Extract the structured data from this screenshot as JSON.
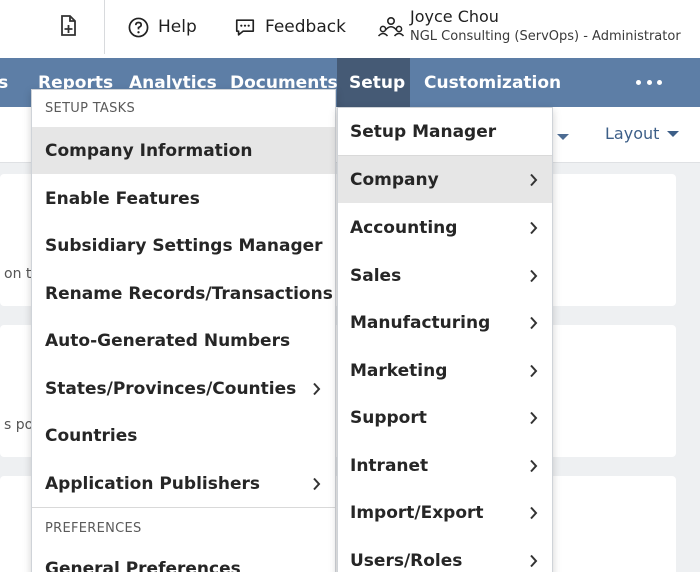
{
  "header": {
    "help_label": "Help",
    "feedback_label": "Feedback",
    "user_name": "Joyce Chou",
    "user_role": "NGL Consulting (ServOps) - Administrator"
  },
  "nav": {
    "items": [
      "ts",
      "Reports",
      "Analytics",
      "Documents",
      "Setup",
      "Customization"
    ],
    "active": "Setup"
  },
  "subbar": {
    "layout_label": "Layout"
  },
  "portlets": {
    "text1": "on t",
    "text2": "s po"
  },
  "setup_tasks": {
    "heading": "SETUP TASKS",
    "items": [
      "Company Information",
      "Enable Features",
      "Subsidiary Settings Manager",
      "Rename Records/Transactions",
      "Auto-Generated Numbers",
      "States/Provinces/Counties",
      "Countries",
      "Application Publishers"
    ],
    "highlighted": "Company Information"
  },
  "preferences": {
    "heading": "PREFERENCES",
    "items": [
      "General Preferences"
    ]
  },
  "setup_menu": {
    "items": [
      "Setup Manager",
      "Company",
      "Accounting",
      "Sales",
      "Manufacturing",
      "Marketing",
      "Support",
      "Intranet",
      "Import/Export",
      "Users/Roles"
    ],
    "highlighted": "Company"
  },
  "colors": {
    "nav_bg": "#5d7ea6",
    "nav_active": "#455a75",
    "link": "#3d5f88",
    "highlight": "#e6e6e6"
  }
}
